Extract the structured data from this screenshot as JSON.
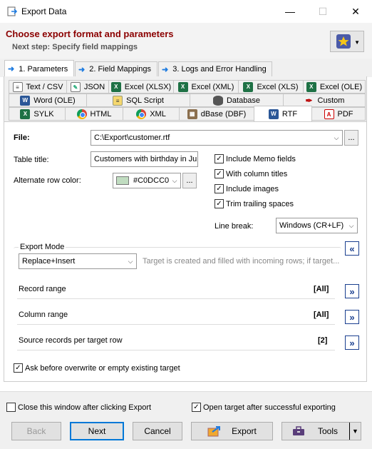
{
  "window": {
    "title": "Export Data",
    "minimize": "—",
    "maximize": "☐",
    "close": "✕"
  },
  "header": {
    "title": "Choose export format and parameters",
    "subtitle": "Next step: Specify field mappings"
  },
  "main_tabs": [
    {
      "label": "1. Parameters",
      "active": true
    },
    {
      "label": "2. Field Mappings",
      "active": false
    },
    {
      "label": "3. Logs and Error Handling",
      "active": false
    }
  ],
  "format_tabs": {
    "row1": [
      "Text / CSV",
      "JSON",
      "Excel (XLSX)",
      "Excel (XML)",
      "Excel (XLS)",
      "Excel (OLE)"
    ],
    "row2": [
      "Word (OLE)",
      "SQL Script",
      "Database",
      "Custom"
    ],
    "row3": [
      "SYLK",
      "HTML",
      "XML",
      "dBase (DBF)",
      "RTF",
      "PDF"
    ],
    "active": "RTF"
  },
  "form": {
    "file_label": "File:",
    "file_value": "C:\\Export\\customer.rtf",
    "table_title_label": "Table title:",
    "table_title_value": "Customers with birthday in Jul",
    "alt_row_color_label": "Alternate row color:",
    "alt_row_color_value": "#C0DCC0",
    "alt_row_color_hex": "#C0DCC0",
    "ellipsis": "...",
    "checkboxes": [
      {
        "label": "Include Memo fields",
        "checked": true
      },
      {
        "label": "With column titles",
        "checked": true
      },
      {
        "label": "Include images",
        "checked": true
      },
      {
        "label": "Trim trailing spaces",
        "checked": true
      }
    ],
    "line_break_label": "Line break:",
    "line_break_value": "Windows (CR+LF)",
    "export_mode_label": "Export Mode",
    "export_mode_value": "Replace+Insert",
    "export_mode_hint": "Target is created and filled with incoming rows; if target...",
    "record_range_label": "Record range",
    "record_range_value": "[All]",
    "column_range_label": "Column range",
    "column_range_value": "[All]",
    "source_records_label": "Source records per target row",
    "source_records_value": "[2]",
    "ask_overwrite_label": "Ask before overwrite or empty existing target",
    "ask_overwrite_checked": true
  },
  "footer": {
    "close_after_label": "Close this window after clicking Export",
    "close_after_checked": false,
    "open_target_label": "Open target after successful exporting",
    "open_target_checked": true,
    "buttons": {
      "back": "Back",
      "next": "Next",
      "cancel": "Cancel",
      "export": "Export",
      "tools": "Tools"
    }
  },
  "colors": {
    "header_title": "#8b0000",
    "accent_blue": "#1e7be0",
    "nav_button": "#1a3f8f"
  }
}
